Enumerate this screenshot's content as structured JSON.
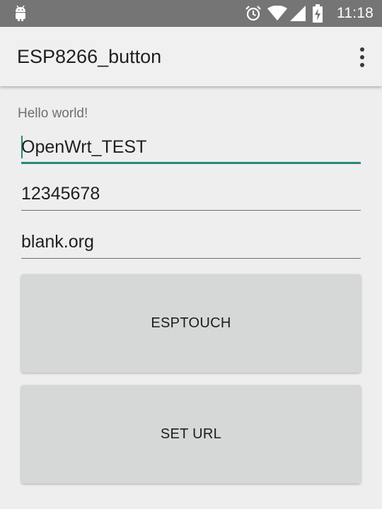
{
  "status_bar": {
    "time": "11:18",
    "icons": [
      "android-debug-icon",
      "alarm-icon",
      "wifi-icon",
      "signal-icon",
      "battery-charging-icon"
    ]
  },
  "app_bar": {
    "title": "ESP8266_button",
    "overflow_icon": "more-vert-icon"
  },
  "main": {
    "hello_text": "Hello world!",
    "ssid_value": "OpenWrt_TEST",
    "password_value": "12345678",
    "url_value": "blank.org",
    "esptouch_label": "ESPTOUCH",
    "set_url_label": "SET URL"
  },
  "colors": {
    "status_bar_bg": "#757575",
    "app_bar_bg": "#f0f0f0",
    "background": "#eeeeee",
    "accent": "#26877a",
    "button_bg": "#d6d7d7"
  }
}
